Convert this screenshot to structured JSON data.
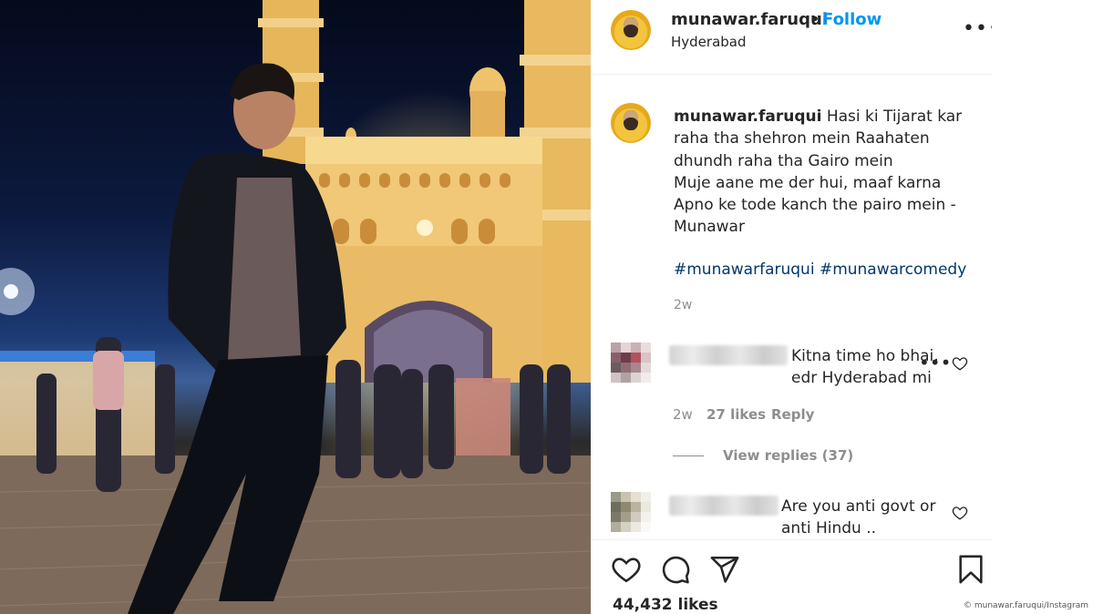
{
  "post": {
    "username": "munawar.faruqui",
    "dot": "•",
    "follow_label": "Follow",
    "location": "Hyderabad",
    "more_label": "•••"
  },
  "caption": {
    "username": "munawar.faruqui",
    "text": " Hasi ki Tijarat kar\nraha tha shehron mein Raahaten\ndhundh raha tha Gairo mein\nMuje aane me der hui, maaf karna\nApno ke tode kanch the pairo mein -\nMunawar",
    "hashtags": [
      "#munawarfaruqui",
      "#munawarcomedy"
    ],
    "time": "2w"
  },
  "comments": [
    {
      "text": "Kitna time ho bhai,\nedr Hyderabad mi",
      "time": "2w",
      "likes": "27 likes",
      "reply_label": "Reply",
      "view_replies": "View replies (37)"
    },
    {
      "text": "Are you anti govt or\nanti Hindu .."
    }
  ],
  "likes_count": "44,432 likes",
  "credit": "© munawar.faruqui/Instagram",
  "colors": {
    "accent_blue": "#0095f6",
    "hashtag": "#00376b",
    "secondary_text": "#8e8e8e"
  },
  "icons": [
    "heart-icon",
    "comment-icon",
    "share-icon",
    "bookmark-icon",
    "more-icon"
  ]
}
